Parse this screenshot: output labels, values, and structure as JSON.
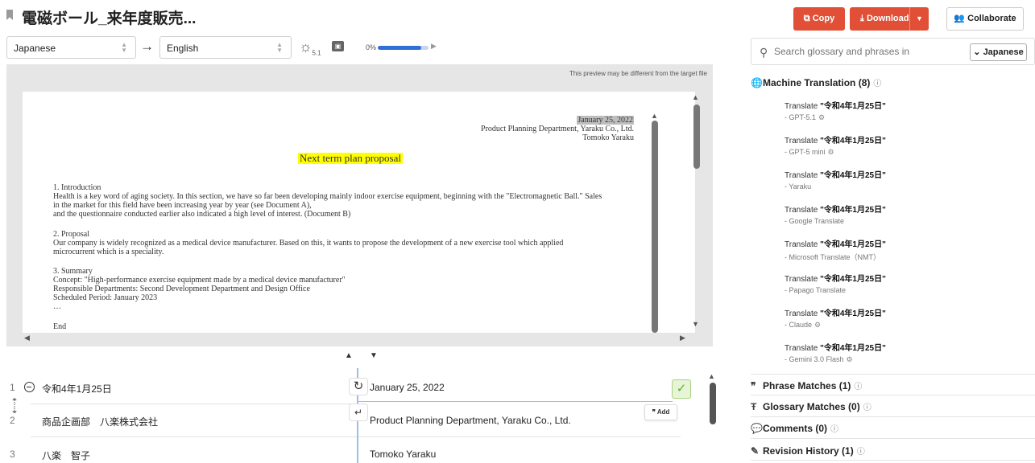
{
  "document": {
    "title": "電磁ボール_来年度販売..."
  },
  "language_bar": {
    "source_lang": "Japanese",
    "target_lang": "English",
    "engine_version": "5.1",
    "progress_label": "0%",
    "progress_value": 0.85
  },
  "preview": {
    "note": "This preview may be different from the target file",
    "date": "January 25, 2022",
    "dept": "Product Planning Department, Yaraku Co., Ltd.",
    "author": "Tomoko Yaraku",
    "heading": "Next term plan proposal",
    "p1": [
      "1. Introduction",
      "Health is a key word of aging society. In this section, we have so far been developing mainly indoor exercise equipment, beginning with the \"Electromagnetic Ball.\" Sales",
      "in the market for this field have been increasing year by year (see Document A),",
      "and the questionnaire conducted earlier also indicated a high level of interest. (Document B)"
    ],
    "p2": [
      "2. Proposal",
      "Our company is widely recognized as a medical device manufacturer. Based on this, it wants to propose the development of a new exercise tool which applied",
      "microcurrent which is a speciality."
    ],
    "p3": [
      "3. Summary",
      "Concept: \"High-performance exercise equipment made by a medical device manufacturer\"",
      "Responsible Departments: Second Development Department and Design Office",
      "Scheduled Period: January 2023",
      "…"
    ],
    "end": "End"
  },
  "segments": [
    {
      "num": "1",
      "source": "令和4年1月25日",
      "target": "January 25, 2022"
    },
    {
      "num": "2",
      "source": "商品企画部　八楽株式会社",
      "target": "Product Planning Department, Yaraku Co., Ltd."
    },
    {
      "num": "3",
      "source": "八楽　智子",
      "target": "Tomoko Yaraku"
    }
  ],
  "segment_actions": {
    "add_label": "Add"
  },
  "toolbar": {
    "copy": "Copy",
    "download": "Download",
    "collaborate": "Collaborate"
  },
  "search": {
    "placeholder": "Search glossary and phrases in",
    "lang": "Japanese"
  },
  "panel": {
    "machine_translation": "Machine Translation (8)",
    "phrase_matches": "Phrase Matches (1)",
    "glossary_matches": "Glossary Matches (0)",
    "comments": "Comments (0)",
    "revision_history": "Revision History (1)"
  },
  "mt_results": [
    {
      "prefix": "Translate ",
      "text": "\"令和4年1月25日\"",
      "engine": "- GPT-5.1"
    },
    {
      "prefix": "Translate ",
      "text": "\"令和4年1月25日\"",
      "engine": "- GPT-5 mini"
    },
    {
      "prefix": "Translate ",
      "text": "\"令和4年1月25日\"",
      "engine": "- Yaraku"
    },
    {
      "prefix": "Translate ",
      "text": "\"令和4年1月25日\"",
      "engine": "- Google Translate"
    },
    {
      "prefix": "Translate ",
      "text": "\"令和4年1月25日\"",
      "engine": "- Microsoft Translate（NMT）"
    },
    {
      "prefix": "Translate ",
      "text": "\"令和4年1月25日\"",
      "engine": "- Papago Translate"
    },
    {
      "prefix": "Translate ",
      "text": "\"令和4年1月25日\"",
      "engine": "- Claude"
    },
    {
      "prefix": "Translate ",
      "text": "\"令和4年1月25日\"",
      "engine": "- Gemini 3.0 Flash"
    }
  ]
}
